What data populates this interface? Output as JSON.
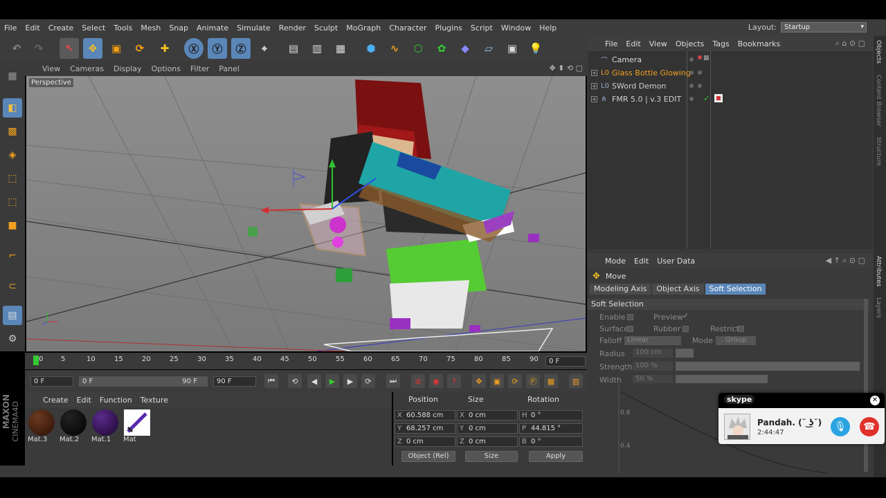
{
  "menu": [
    "File",
    "Edit",
    "Create",
    "Select",
    "Tools",
    "Mesh",
    "Snap",
    "Animate",
    "Simulate",
    "Render",
    "Sculpt",
    "MoGraph",
    "Character",
    "Plugins",
    "Script",
    "Window",
    "Help"
  ],
  "layout": {
    "label": "Layout:",
    "value": "Startup"
  },
  "viewport_menu": [
    "View",
    "Cameras",
    "Display",
    "Options",
    "Filter",
    "Panel"
  ],
  "viewport_label": "Perspective",
  "timeline": {
    "ticks": [
      "0",
      "5",
      "10",
      "15",
      "20",
      "25",
      "30",
      "35",
      "40",
      "45",
      "50",
      "55",
      "60",
      "65",
      "70",
      "75",
      "80",
      "85",
      "90"
    ],
    "current_frame": "0 F"
  },
  "transport": {
    "start": "0 F",
    "range_start": "0 F",
    "range_end": "90 F",
    "end": "90 F"
  },
  "materials_menu": [
    "Create",
    "Edit",
    "Function",
    "Texture"
  ],
  "materials": [
    {
      "name": "Mat.3",
      "color": "#3a1a0a"
    },
    {
      "name": "Mat.2",
      "color": "#050505"
    },
    {
      "name": "Mat.1",
      "color": "#2a0a4a"
    },
    {
      "name": "Mat",
      "color": "#ffffff"
    }
  ],
  "coords": {
    "headers": [
      "Position",
      "Size",
      "Rotation"
    ],
    "rows": [
      {
        "axis": "X",
        "pos": "60.588 cm",
        "size_axis": "X",
        "size": "0 cm",
        "rot_axis": "H",
        "rot": "0 °"
      },
      {
        "axis": "Y",
        "pos": "68.257 cm",
        "size_axis": "Y",
        "size": "0 cm",
        "rot_axis": "P",
        "rot": "44.815 °"
      },
      {
        "axis": "Z",
        "pos": "0 cm",
        "size_axis": "Z",
        "size": "0 cm",
        "rot_axis": "B",
        "rot": "0 °"
      }
    ],
    "mode": "Object (Rel)",
    "size_mode": "Size",
    "apply": "Apply"
  },
  "maxon": {
    "line1": "MAXON",
    "line2": "CINEMA4D"
  },
  "objects_menu": [
    "File",
    "Edit",
    "View",
    "Objects",
    "Tags",
    "Bookmarks"
  ],
  "objects": [
    {
      "name": "Camera",
      "color": "#dcdcdc",
      "expand": false
    },
    {
      "name": "Glass Bottle Glowing",
      "color": "#f0a020",
      "expand": true
    },
    {
      "name": "SWord Demon",
      "color": "#dcdcdc",
      "expand": true
    },
    {
      "name": "FMR 5.0 | v.3 EDIT",
      "color": "#dcdcdc",
      "expand": true
    }
  ],
  "side_tabs_top": [
    "Objects",
    "Content Browser",
    "Structure"
  ],
  "side_tabs_bottom": [
    "Attributes",
    "Layers"
  ],
  "attributes_menu": [
    "Mode",
    "Edit",
    "User Data"
  ],
  "attributes": {
    "tool_name": "Move",
    "tabs": [
      "Modeling Axis",
      "Object Axis",
      "Soft Selection"
    ],
    "active_tab": "Soft Selection",
    "section": "Soft Selection",
    "enable": "Enable",
    "preview": "Preview",
    "surface": "Surface",
    "rubber": "Rubber",
    "restrict": "Restrict",
    "falloff": "Falloff",
    "falloff_value": "Linear",
    "mode": "Mode",
    "mode_value": "Group",
    "radius": "Radius",
    "radius_value": "100 cm",
    "strength": "Strength",
    "strength_value": "100 %",
    "width": "Width",
    "width_value": "50 %",
    "graph_labels": [
      "0.8",
      "0.4"
    ]
  },
  "skype": {
    "brand": "skype",
    "caller": "Pandah. (˘ ͜ʖ˘)",
    "duration": "2:44:47"
  }
}
